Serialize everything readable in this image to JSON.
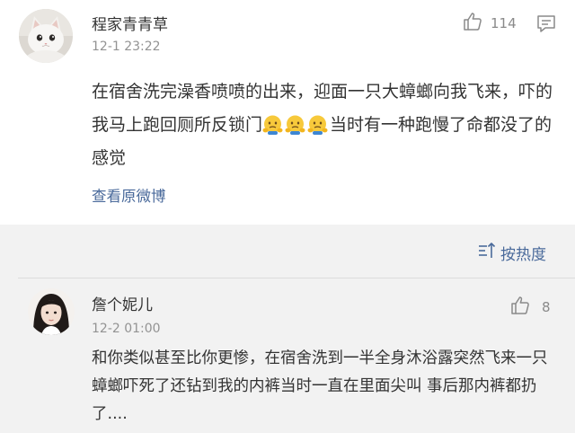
{
  "main_comment": {
    "username": "程家青青草",
    "time": "12-1 23:22",
    "like_count": "114",
    "text_before_emoji": "在宿舍洗完澡香喷喷的出来，迎面一只大蟑螂向我飞来，吓的我马上跑回厕所反锁门",
    "emojis": [
      "facepalm-emoji",
      "facepalm-emoji",
      "facepalm-emoji"
    ],
    "text_after_emoji": "当时有一种跑慢了命都没了的感觉",
    "view_original_label": "查看原微博"
  },
  "sort": {
    "label": "按热度"
  },
  "reply": {
    "username": "詹个妮儿",
    "time": "12-2 01:00",
    "like_count": "8",
    "text": "和你类似甚至比你更惨，在宿舍洗到一半全身沐浴露突然飞来一只蟑螂吓死了还钻到我的内裤当时一直在里面尖叫 事后那内裤都扔了...."
  },
  "colors": {
    "link_blue": "#4a6a9b",
    "meta_grey": "#939393",
    "reply_background": "#f2f2f2"
  }
}
